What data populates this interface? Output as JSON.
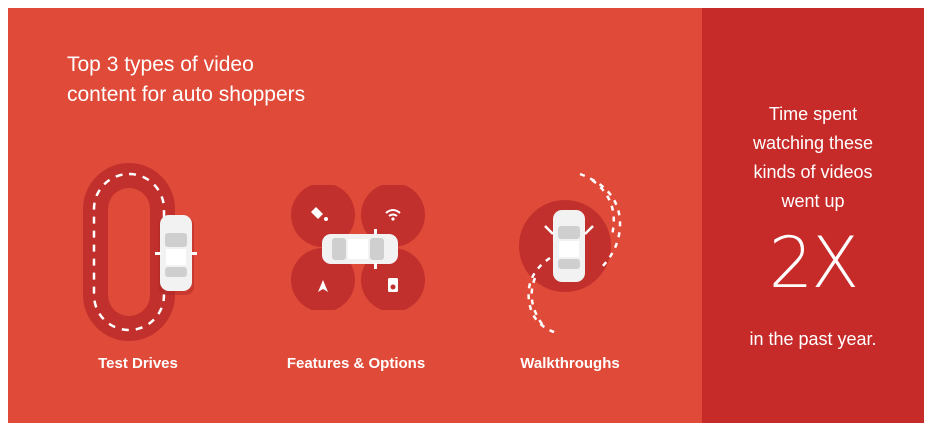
{
  "headline": {
    "line1": "Top 3 types of video",
    "line2": "content for auto shoppers"
  },
  "categories": [
    {
      "label": "Test Drives",
      "icon": "oval-track-car-icon"
    },
    {
      "label": "Features & Options",
      "icon": "car-features-icon"
    },
    {
      "label": "Walkthroughs",
      "icon": "car-walkthrough-icon"
    }
  ],
  "stat": {
    "line1": "Time spent",
    "line2": "watching these",
    "line3": "kinds of videos",
    "line4": "went up",
    "value": "2X",
    "outro": "in the past year."
  },
  "colors": {
    "panel_main": "#e04a38",
    "panel_side": "#c62a29",
    "track": "#c1302c",
    "text": "#ffffff"
  }
}
